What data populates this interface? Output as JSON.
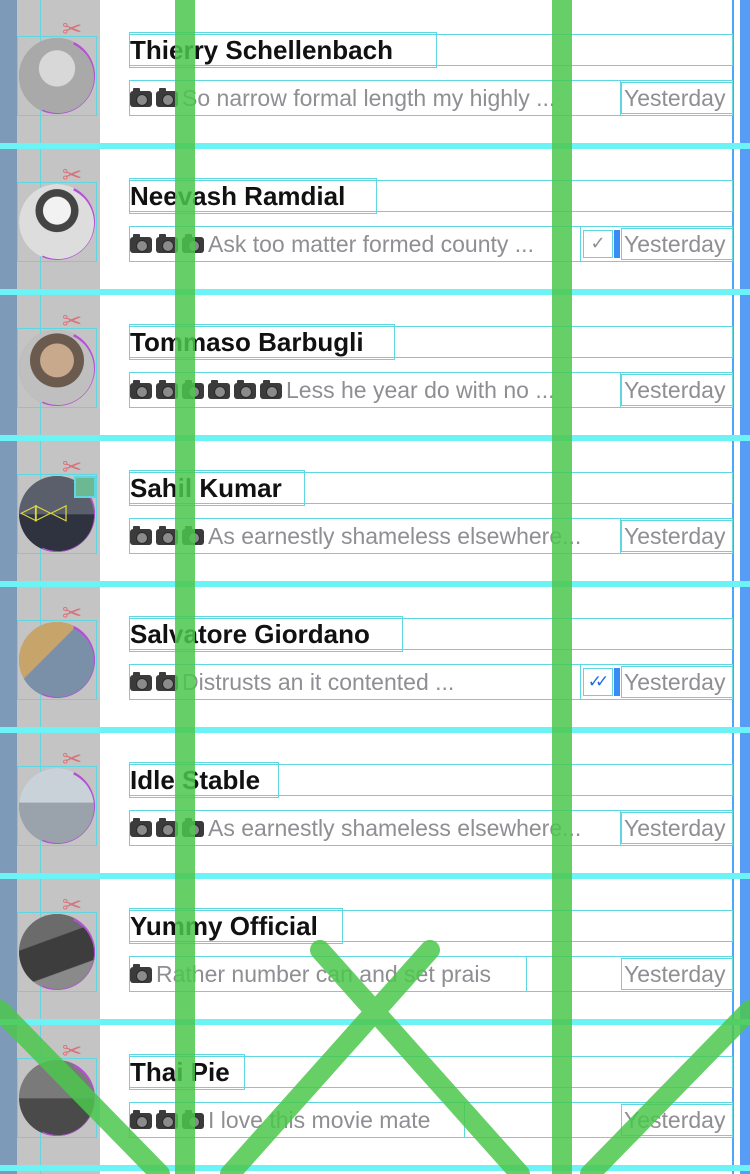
{
  "colors": {
    "name": "#111111",
    "preview": "#8e8e93",
    "read_check": "#1e6ee8",
    "avatar_ring": "#b54fd6",
    "guide": "#5fd6e0",
    "row_separator": "#6cf3f5",
    "side_strip": "#c4c4c4",
    "overlay_stroke": "#4cc74c"
  },
  "icons": {
    "photo": "camera-icon",
    "clip": "scissors-icon",
    "sent": "single-check-icon",
    "read": "double-check-icon"
  },
  "chats": [
    {
      "name": "Thierry Schellenbach",
      "photos": 2,
      "preview": "So narrow formal length my highly ...",
      "time": "Yesterday",
      "status": "none"
    },
    {
      "name": "Neevash Ramdial",
      "photos": 3,
      "preview": "Ask too matter formed county ...",
      "time": "Yesterday",
      "status": "sent"
    },
    {
      "name": "Tommaso Barbugli",
      "photos": 6,
      "preview": "Less he year do with no ...",
      "time": "Yesterday",
      "status": "none"
    },
    {
      "name": "Sahil Kumar",
      "photos": 3,
      "preview": "As earnestly shameless elsewhere...",
      "time": "Yesterday",
      "status": "none"
    },
    {
      "name": "Salvatore Giordano",
      "photos": 2,
      "preview": "Distrusts an it contented ...",
      "time": "Yesterday",
      "status": "read"
    },
    {
      "name": "Idle Stable",
      "photos": 3,
      "preview": "As earnestly shameless elsewhere...",
      "time": "Yesterday",
      "status": "none"
    },
    {
      "name": "Yummy Official",
      "photos": 1,
      "preview": "Rather number can and set prais",
      "time": "Yesterday",
      "status": "none"
    },
    {
      "name": "Thai Pie",
      "photos": 3,
      "preview": "I love this movie mate",
      "time": "Yesterday",
      "status": "none"
    }
  ]
}
